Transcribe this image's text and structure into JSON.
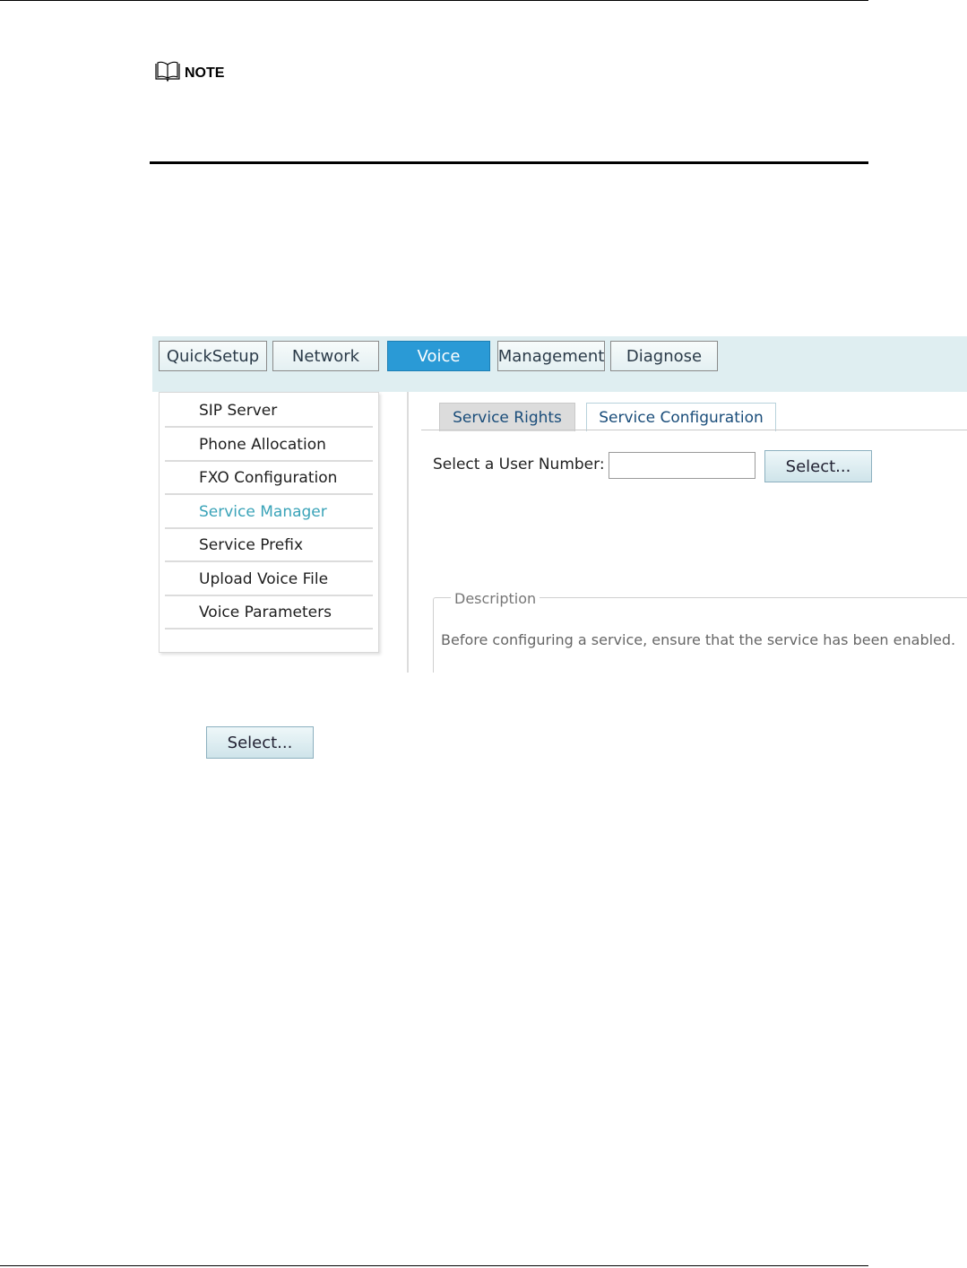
{
  "note": {
    "label": "NOTE",
    "icon": "book-icon"
  },
  "ui": {
    "nav": [
      "QuickSetup",
      "Network",
      "Voice",
      "Management",
      "Diagnose"
    ],
    "nav_active": "Voice",
    "menu": [
      "SIP Server",
      "Phone Allocation",
      "FXO Configuration",
      "Service Manager",
      "Service Prefix",
      "Upload Voice File",
      "Voice Parameters"
    ],
    "menu_active": "Service Manager",
    "tabs": [
      "Service Rights",
      "Service Configuration"
    ],
    "tab_active": "Service Configuration",
    "user_number_label": "Select a User Number:",
    "user_number_value": "",
    "select_button": "Select...",
    "description_legend": "Description",
    "description_text": "Before configuring a service, ensure that the service has been enabled."
  },
  "standalone_select_button": "Select...",
  "colors": {
    "nav_bg": "#dfeef1",
    "active_nav": "#2a9ad6",
    "active_menu_text": "#3aa3b8",
    "tab_text": "#1a4d7a"
  }
}
